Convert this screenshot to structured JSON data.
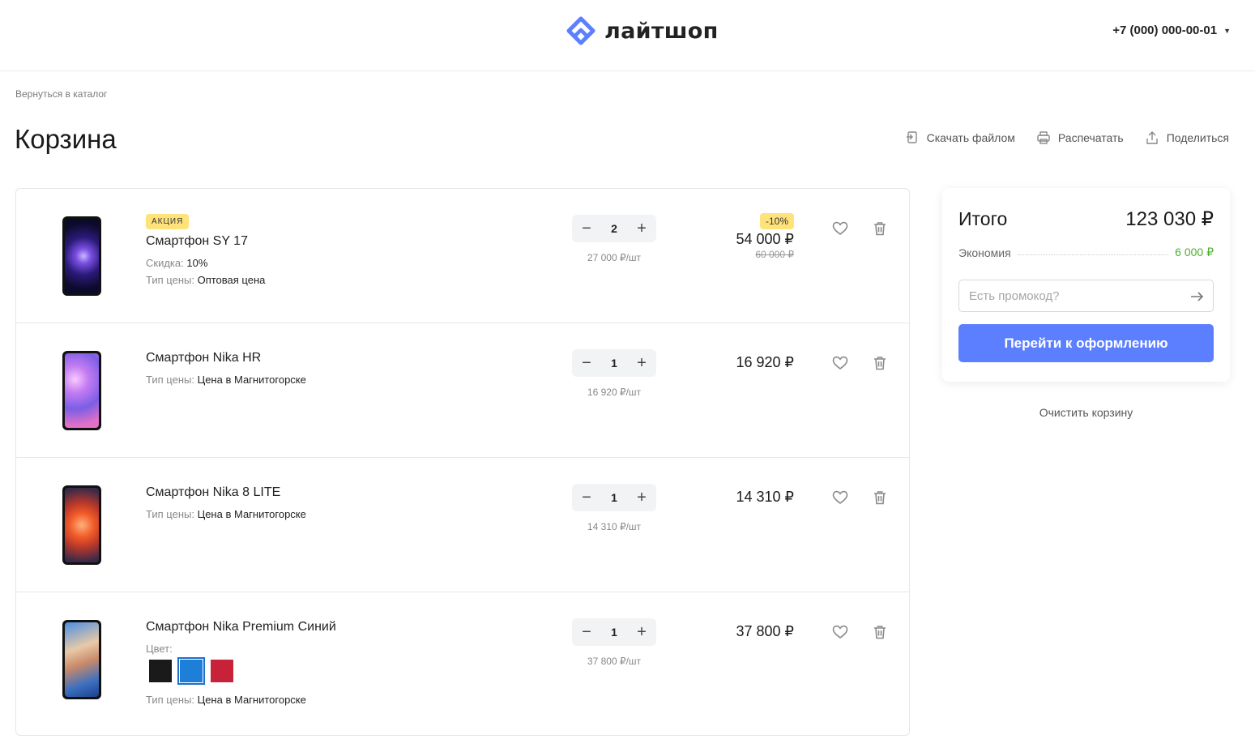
{
  "header": {
    "brand": "лайтшоп",
    "phone": "+7 (000) 000-00-01",
    "accent_color": "#5b7fff"
  },
  "breadcrumb": {
    "back_label": "Вернуться в каталог"
  },
  "page": {
    "title": "Корзина"
  },
  "actions": {
    "download_label": "Скачать файлом",
    "print_label": "Распечатать",
    "share_label": "Поделиться"
  },
  "cart": {
    "items": [
      {
        "badge": "АКЦИЯ",
        "name": "Смартфон SY 17",
        "discount_label": "Скидка:",
        "discount_value": "10%",
        "price_type_label": "Тип цены:",
        "price_type": "Оптовая цена",
        "quantity": "2",
        "unit_price": "27 000 ₽/шт",
        "discount_badge": "-10%",
        "price": "54 000 ₽",
        "old_price": "60 000 ₽"
      },
      {
        "name": "Смартфон Nika HR",
        "price_type_label": "Тип цены:",
        "price_type": "Цена в Магнитогорске",
        "quantity": "1",
        "unit_price": "16 920 ₽/шт",
        "price": "16 920 ₽"
      },
      {
        "name": "Смартфон Nika 8 LITE",
        "price_type_label": "Тип цены:",
        "price_type": "Цена в Магнитогорске",
        "quantity": "1",
        "unit_price": "14 310 ₽/шт",
        "price": "14 310 ₽"
      },
      {
        "name": "Смартфон Nika Premium Синий",
        "color_label": "Цвет:",
        "colors": [
          "#1a1a1a",
          "#1e7fd9",
          "#c8223a"
        ],
        "selected_color": "#1e7fd9",
        "price_type_label": "Тип цены:",
        "price_type": "Цена в Магнитогорске",
        "quantity": "1",
        "unit_price": "37 800 ₽/шт",
        "price": "37 800 ₽"
      }
    ]
  },
  "summary": {
    "total_label": "Итого",
    "total_value": "123 030 ₽",
    "savings_label": "Экономия",
    "savings_value": "6 000 ₽",
    "promo_placeholder": "Есть промокод?",
    "checkout_label": "Перейти к оформлению",
    "clear_label": "Очистить корзину"
  }
}
